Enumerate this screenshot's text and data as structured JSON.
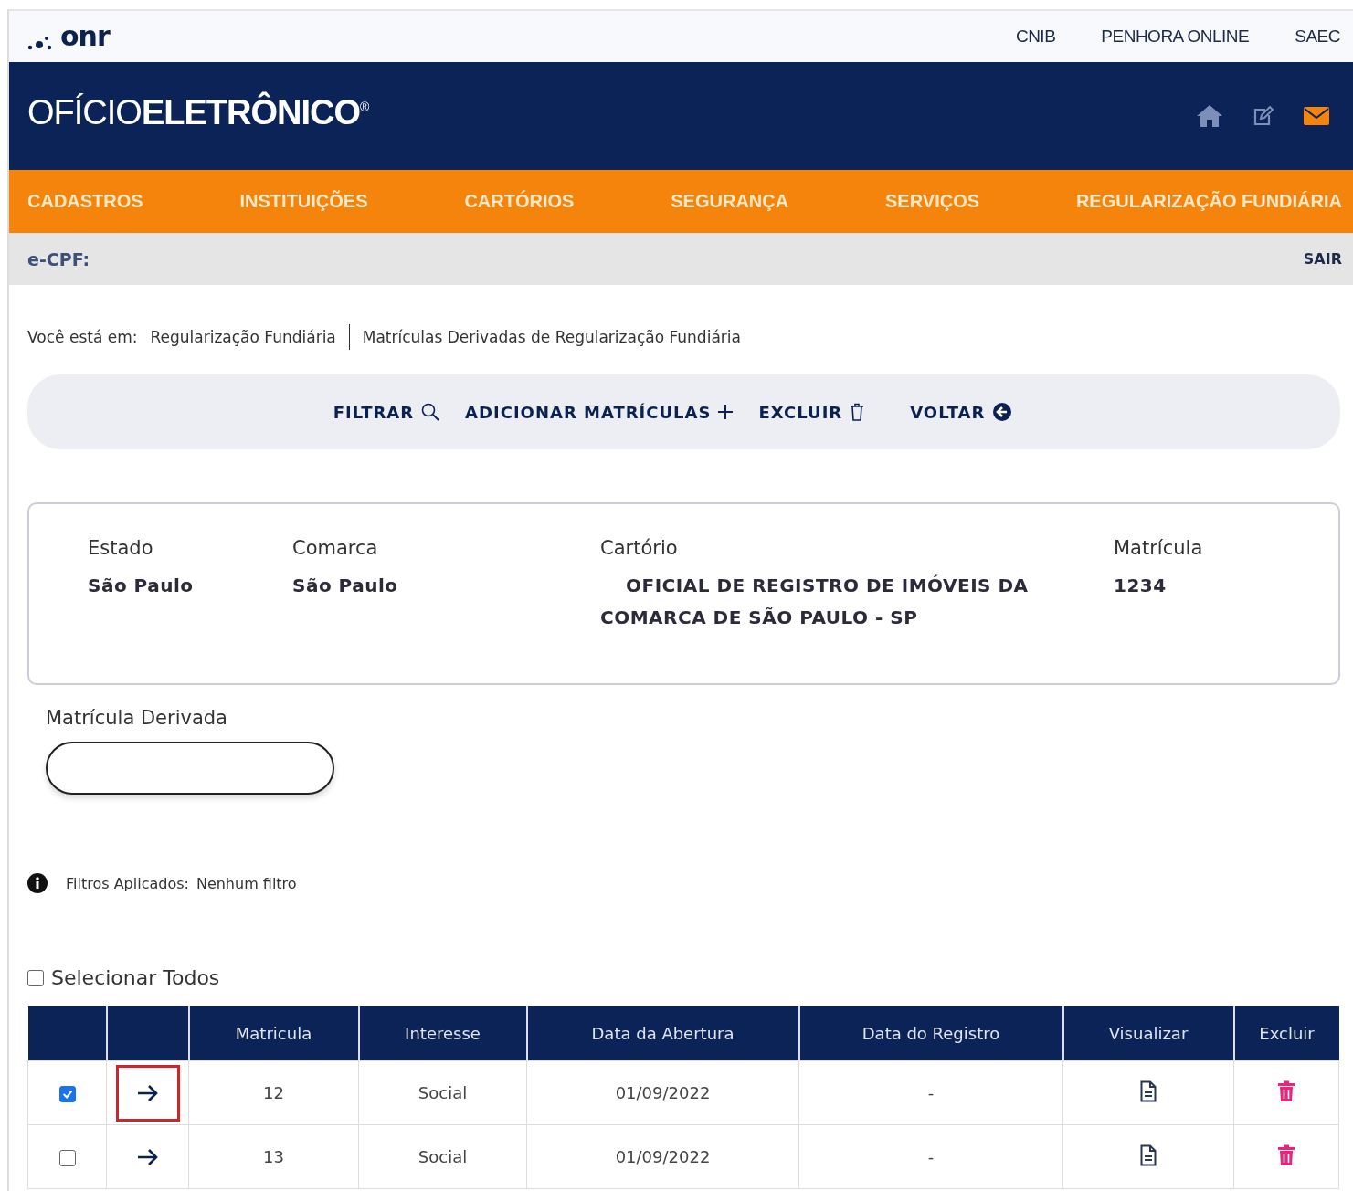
{
  "brand": {
    "logo": "onr",
    "links": [
      "CNIB",
      "PENHORA ONLINE",
      "SAEC"
    ]
  },
  "header": {
    "title": "OFÍCIO**ELETRÔNICO**$^{®}$"
  },
  "menu": [
    "CADASTROS",
    "INSTITUIÇÕES",
    "CARTÓRIOS",
    "SEGURANÇA",
    "SERVIÇOS",
    "REGULARIZAÇÃO FUNDIÁRIA"
  ],
  "user_bar": {
    "label": "e-CPF:",
    "logout": "SAIR"
  },
  "breadcrumb": {
    "prefix": "Você está em:",
    "items": [
      "Regularização Fundiária",
      "Matrículas Derivadas de Regularização Fundiária"
    ]
  },
  "toolbar": [
    {
      "label": "FILTRAR",
      "kind": "search"
    },
    {
      "label": "ADICIONAR MATRÍCULAS",
      "kind": "add"
    },
    {
      "label": "EXCLUIR",
      "kind": "delete"
    },
    {
      "label": "VOLTAR",
      "kind": "back"
    }
  ],
  "details": [
    {
      "label": "Estado",
      "value": "São Paulo"
    },
    {
      "label": "Comarca",
      "value": "São Paulo"
    },
    {
      "label": "Cartório",
      "value": "OFICIAL DE REGISTRO DE IMÓVEIS DA COMARCA DE SÃO PAULO - SP"
    },
    {
      "label": "Matrícula",
      "value": "1234"
    }
  ],
  "filter_field": {
    "label": "Matrícula Derivada"
  },
  "filters_applied": {
    "label": "Filtros Aplicados:",
    "value": "Nenhum filtro"
  },
  "select_all": {
    "label": "Selecionar Todos",
    "checked": false
  },
  "table": {
    "columns": [
      "Matricula",
      "Interesse",
      "Data da Abertura",
      "Data do Registro",
      "Visualizar",
      "Excluir"
    ],
    "rows": [
      {
        "checked": true,
        "highlighted": true,
        "matricula": "12",
        "interesse": "Social",
        "data_abertura": "01/09/2022",
        "data_registro": "-"
      },
      {
        "checked": false,
        "highlighted": false,
        "matricula": "13",
        "interesse": "Social",
        "data_abertura": "01/09/2022",
        "data_registro": "-"
      }
    ]
  }
}
